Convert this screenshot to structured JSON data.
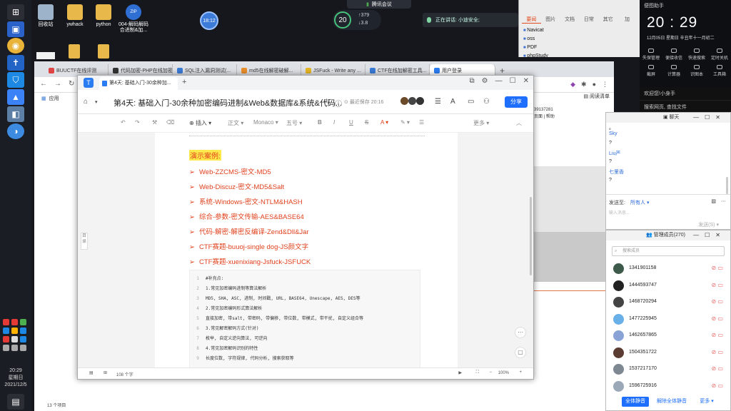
{
  "desktop": {
    "icons": [
      {
        "label": "回收站",
        "color": "#9db3c9"
      },
      {
        "label": "ywhack",
        "color": "#e8b94a"
      },
      {
        "label": "python",
        "color": "#e8b94a"
      },
      {
        "label": "004-解码解码\n合进制&加...",
        "color": "#2f6fd4"
      }
    ],
    "row2_icons": [
      {
        "label": "内",
        "color": "#f0f0f0"
      },
      {
        "label": "",
        "color": "#e8b94a"
      },
      {
        "label": "",
        "color": "#e8b94a"
      }
    ]
  },
  "taskbar": {
    "clock_time": "20:29",
    "clock_day": "星期日",
    "clock_date": "2021/12/5"
  },
  "overlay": {
    "circle_text": "18:12",
    "meeting_label": "腾讯会议",
    "speed_number": "20",
    "speed_up": "379",
    "speed_down": "3.8",
    "speaking_text": "正在讲话: 小迪安全;"
  },
  "news": {
    "tabs": [
      "要闻",
      "图片",
      "文档",
      "日常",
      "其它",
      "加"
    ],
    "items": [
      "Navicat",
      "oss",
      "PDF",
      "phpStudy"
    ]
  },
  "clock_panel": {
    "header": "便图助手",
    "time": "20 : 29",
    "date": "12月05日  星期日    辛丑年十一月初二",
    "tools": [
      "失保管理",
      "便接收信",
      "快速搜索",
      "定时关机",
      "截屏",
      "计算器",
      "识图本",
      "工具箱"
    ],
    "search_1": "欢迎您!小身手",
    "search_2": "搜索网页, 查找文件"
  },
  "browser": {
    "tabs": [
      {
        "title": "BUUCTF在线评测",
        "color": "#d44"
      },
      {
        "title": "代码加密-PHP在线加密",
        "color": "#333"
      },
      {
        "title": "SQL注入漏洞测试(...",
        "color": "#3a7bd5"
      },
      {
        "title": "md5在线解密破解...",
        "color": "#e88e2a"
      },
      {
        "title": "JSFuck - Write any ...",
        "color": "#e5b625"
      },
      {
        "title": "CTF在线加解密工具...",
        "color": "#3a7bd5"
      },
      {
        "title": "用户登录",
        "color": "#2a7cf2"
      }
    ],
    "bookmarks_label": "应用",
    "reading_list": "阅读清单",
    "bg_text_1": "39137281",
    "bg_text_2": "页面 | 帮助",
    "status": "13 个项目"
  },
  "doc": {
    "tab_title": "第4天: 基础入门-30余种加...",
    "title": "第4天: 基础入门-30余种加密编码进制&Web&数据库&系统&代码...",
    "saved": "最近保存 20:16",
    "share": "分享",
    "toolbar": {
      "insert": "插入",
      "style": "正文",
      "font": "Monaco",
      "size": "五号",
      "more": "更多"
    },
    "demo_label": "演示案例:",
    "demo_items": [
      "Web-ZZCMS-密文-MD5",
      "Web-Discuz-密文-MD5&Salt",
      "系统-Windows-密文-NTLM&HASH",
      "综合-参数-密文传输-AES&BASE64",
      "代码-解密-解密反编译-Zend&Dll&Jar",
      "CTF赛题-buuoj-single dog-JS颜文字",
      "CTF赛题-xuenixiang-Jsfuck-JSFUCK"
    ],
    "code_lines": [
      {
        "n": "1",
        "t": "#补充点:"
      },
      {
        "n": "2",
        "t": "1.常见加密编码进制等算法解析"
      },
      {
        "n": "3",
        "t": "MD5, SHA, ASC, 进制, 时间戳, URL, BASE64, Unescape, AES, DES等"
      },
      {
        "n": "4",
        "t": "2.常见加密编码形式算法解析"
      },
      {
        "n": "5",
        "t": "直接加密, 带salt, 带密码, 带偏移, 带位数, 带模式, 带干扰, 自定义组合等"
      },
      {
        "n": "6",
        "t": "3.常见解密解码方式(针对)"
      },
      {
        "n": "7",
        "t": "枚举, 自定义逆向算法, 可逆向"
      },
      {
        "n": "8",
        "t": "4.常见加密解码识别的特性"
      },
      {
        "n": "9",
        "t": "长度位数, 字符规律, 代码分析, 搜索获取等"
      }
    ],
    "catalog": "目录",
    "word_count": "108 个字",
    "zoom": "100%"
  },
  "chat": {
    "title": "聊天",
    "messages": [
      {
        "type": "text",
        "v": "。"
      },
      {
        "type": "name",
        "v": "Sky"
      },
      {
        "type": "text",
        "v": "?"
      },
      {
        "type": "name",
        "v": "Liu严"
      },
      {
        "type": "text",
        "v": "?"
      },
      {
        "type": "name",
        "v": "七里香"
      },
      {
        "type": "text",
        "v": "?"
      }
    ],
    "send_to": "发送至:",
    "recipient": "所有人",
    "placeholder": "输入消息...",
    "send": "发送(S)"
  },
  "members": {
    "title": "管理成员(270)",
    "search_placeholder": "搜索成员",
    "list": [
      {
        "num": "1341901158",
        "color": "#3d5a4a"
      },
      {
        "num": "1444593747",
        "color": "#222"
      },
      {
        "num": "1468720294",
        "color": "#444"
      },
      {
        "num": "1477225945",
        "color": "#6ab0e8"
      },
      {
        "num": "1462657865",
        "color": "#8aa3d6"
      },
      {
        "num": "1504351722",
        "color": "#5a3c32"
      },
      {
        "num": "1537217170",
        "color": "#7d8893"
      },
      {
        "num": "1596725916",
        "color": "#9aa8b8"
      }
    ],
    "mute_all": "全体静音",
    "unmute_all": "解除全体静音",
    "more": "更多"
  }
}
